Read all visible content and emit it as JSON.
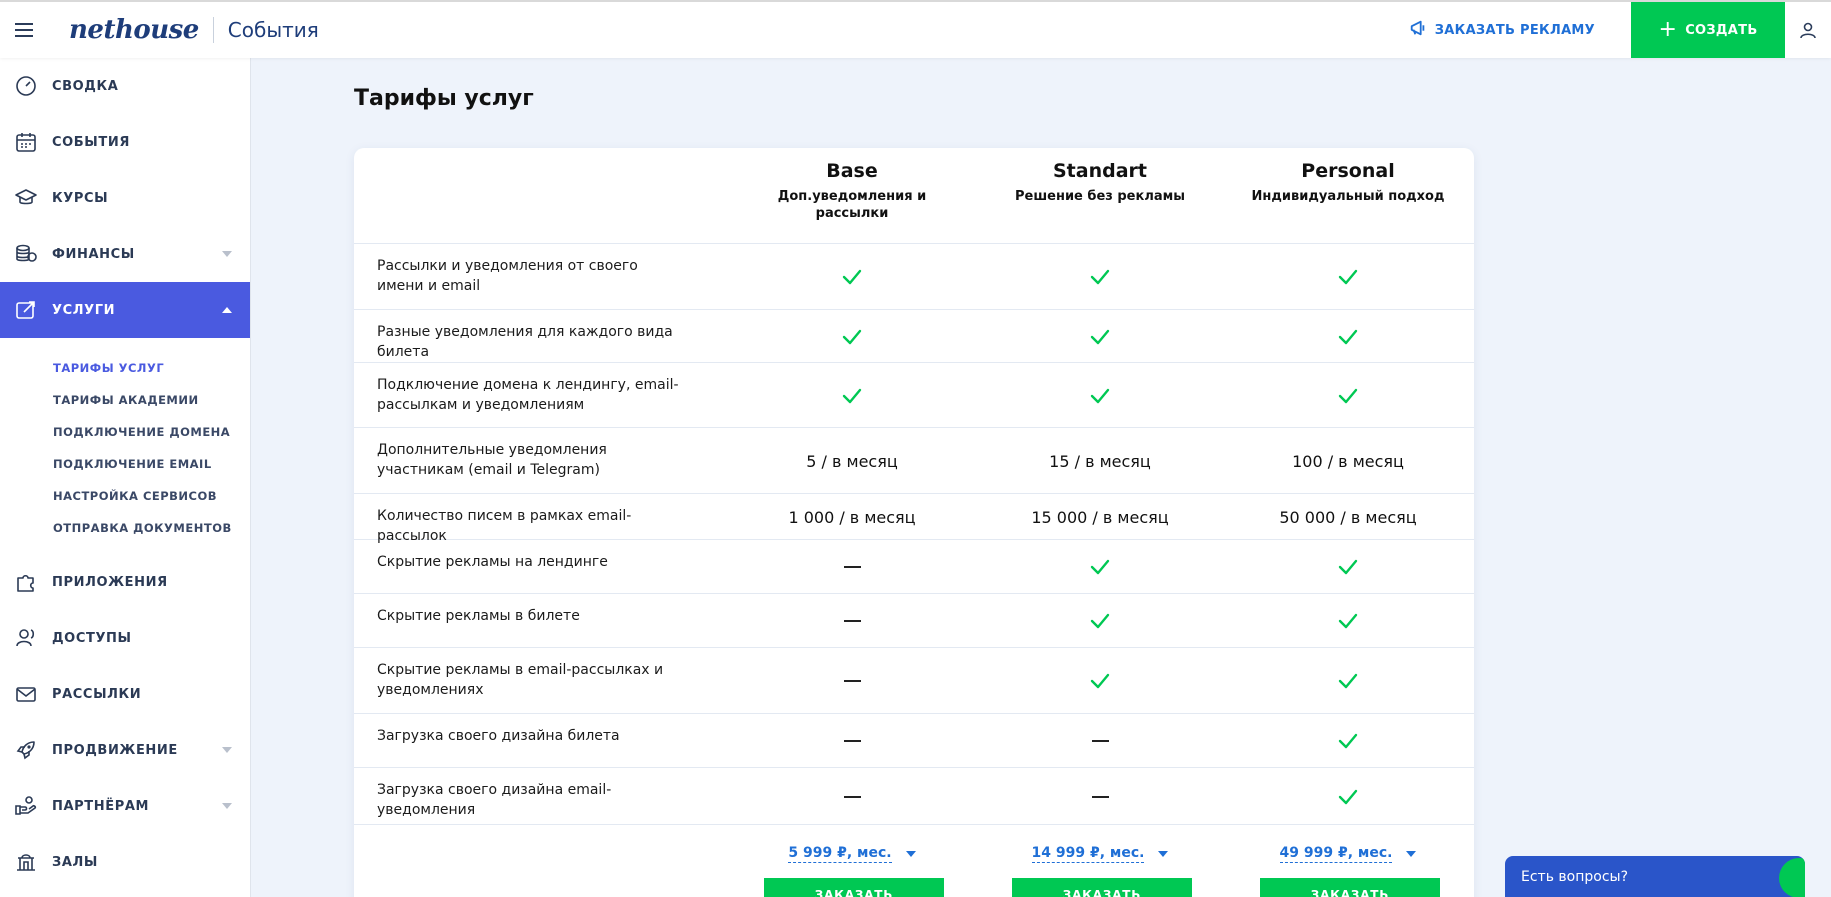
{
  "header": {
    "logo": "nethouse",
    "section": "События",
    "ad_link": "ЗАКАЗАТЬ РЕКЛАМУ",
    "create_label": "СОЗДАТЬ",
    "icons": {
      "menu": "hamburger-icon",
      "ad": "megaphone-icon",
      "user": "user-icon"
    }
  },
  "sidebar": {
    "items": [
      {
        "label": "СВОДКА",
        "icon": "dashboard-icon"
      },
      {
        "label": "СОБЫТИЯ",
        "icon": "calendar-icon"
      },
      {
        "label": "КУРСЫ",
        "icon": "graduation-cap-icon"
      },
      {
        "label": "ФИНАНСЫ",
        "icon": "coins-icon"
      },
      {
        "label": "УСЛУГИ",
        "icon": "services-icon"
      },
      {
        "label": "ПРИЛОЖЕНИЯ",
        "icon": "puzzle-icon"
      },
      {
        "label": "ДОСТУПЫ",
        "icon": "users-icon"
      },
      {
        "label": "РАССЫЛКИ",
        "icon": "mail-icon"
      },
      {
        "label": "ПРОДВИЖЕНИЕ",
        "icon": "rocket-icon"
      },
      {
        "label": "ПАРТНЁРАМ",
        "icon": "handshake-icon"
      },
      {
        "label": "ЗАЛЫ",
        "icon": "hall-icon"
      }
    ],
    "subitems": [
      "ТАРИФЫ УСЛУГ",
      "ТАРИФЫ АКАДЕМИИ",
      "ПОДКЛЮЧЕНИЕ ДОМЕНА",
      "ПОДКЛЮЧЕНИЕ EMAIL",
      "НАСТРОЙКА СЕРВИСОВ",
      "ОТПРАВКА ДОКУМЕНТОВ"
    ]
  },
  "page": {
    "title": "Тарифы услуг"
  },
  "plans": [
    {
      "name": "Base",
      "subtitle": "Доп.уведомления и рассылки",
      "price": "5 999 ₽, мес.",
      "order": "ЗАКАЗАТЬ"
    },
    {
      "name": "Standart",
      "subtitle": "Решение без рекламы",
      "price": "14 999 ₽, мес.",
      "order": "ЗАКАЗАТЬ"
    },
    {
      "name": "Personal",
      "subtitle": "Индивидуальный подход",
      "price": "49 999 ₽, мес.",
      "order": "ЗАКАЗАТЬ"
    }
  ],
  "features": [
    {
      "label": "Рассылки и уведомления от своего имени и email",
      "values": [
        "check",
        "check",
        "check"
      ]
    },
    {
      "label": "Разные уведомления для каждого вида билета",
      "values": [
        "check",
        "check",
        "check"
      ]
    },
    {
      "label": "Подключение домена к лендингу, email-рассылкам и уведомлениям",
      "values": [
        "check",
        "check",
        "check"
      ]
    },
    {
      "label": "Дополнительные уведомления участникам (email и Telegram)",
      "values": [
        "5 / в месяц",
        "15 / в месяц",
        "100 / в месяц"
      ]
    },
    {
      "label": "Количество писем в рамках email-рассылок",
      "values": [
        "1 000 / в месяц",
        "15 000 / в месяц",
        "50 000 / в месяц"
      ]
    },
    {
      "label": "Скрытие рекламы на лендинге",
      "values": [
        "dash",
        "check",
        "check"
      ]
    },
    {
      "label": "Скрытие рекламы в билете",
      "values": [
        "dash",
        "check",
        "check"
      ]
    },
    {
      "label": "Скрытие рекламы в email-рассылках и уведомлениях",
      "values": [
        "dash",
        "check",
        "check"
      ]
    },
    {
      "label": "Загрузка своего дизайна билета",
      "values": [
        "dash",
        "dash",
        "check"
      ]
    },
    {
      "label": "Загрузка своего дизайна email-уведомления",
      "values": [
        "dash",
        "dash",
        "check"
      ]
    }
  ],
  "chat": {
    "label": "Есть вопросы?"
  },
  "colors": {
    "accent": "#4a5ae0",
    "green": "#00c853",
    "link": "#1f6fd6",
    "background": "#eef3fb"
  }
}
